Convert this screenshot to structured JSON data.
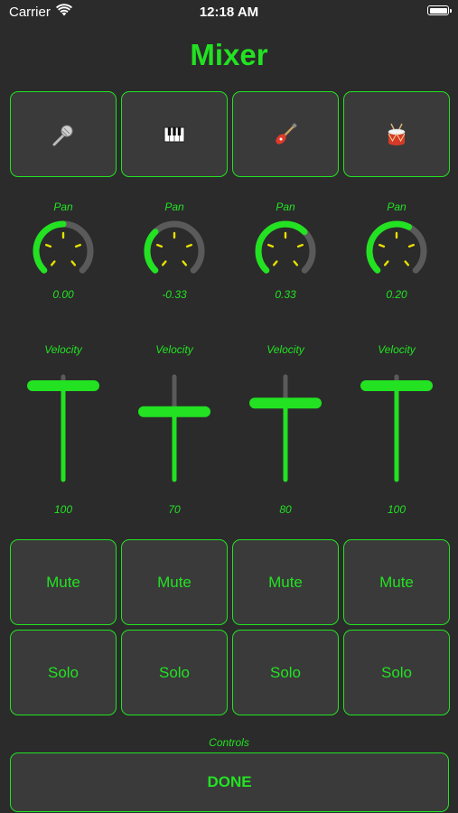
{
  "status_bar": {
    "carrier": "Carrier",
    "time": "12:18 AM"
  },
  "title": "Mixer",
  "instruments": [
    {
      "icon": "microphone-icon"
    },
    {
      "icon": "piano-keys-icon"
    },
    {
      "icon": "electric-guitar-icon"
    },
    {
      "icon": "drum-icon"
    }
  ],
  "channels": [
    {
      "pan_label": "Pan",
      "pan": 0.0,
      "pan_text": "0.00",
      "velocity_label": "Velocity",
      "velocity": 100,
      "velocity_text": "100",
      "mute_label": "Mute",
      "solo_label": "Solo"
    },
    {
      "pan_label": "Pan",
      "pan": -0.33,
      "pan_text": "-0.33",
      "velocity_label": "Velocity",
      "velocity": 70,
      "velocity_text": "70",
      "mute_label": "Mute",
      "solo_label": "Solo"
    },
    {
      "pan_label": "Pan",
      "pan": 0.33,
      "pan_text": "0.33",
      "velocity_label": "Velocity",
      "velocity": 80,
      "velocity_text": "80",
      "mute_label": "Mute",
      "solo_label": "Solo"
    },
    {
      "pan_label": "Pan",
      "pan": 0.2,
      "pan_text": "0.20",
      "velocity_label": "Velocity",
      "velocity": 100,
      "velocity_text": "100",
      "mute_label": "Mute",
      "solo_label": "Solo"
    }
  ],
  "controls_label": "Controls",
  "done_label": "DONE",
  "colors": {
    "accent": "#22e222",
    "background": "#2b2b2b",
    "track": "#5a5a5a",
    "tick": "#e8e000"
  }
}
